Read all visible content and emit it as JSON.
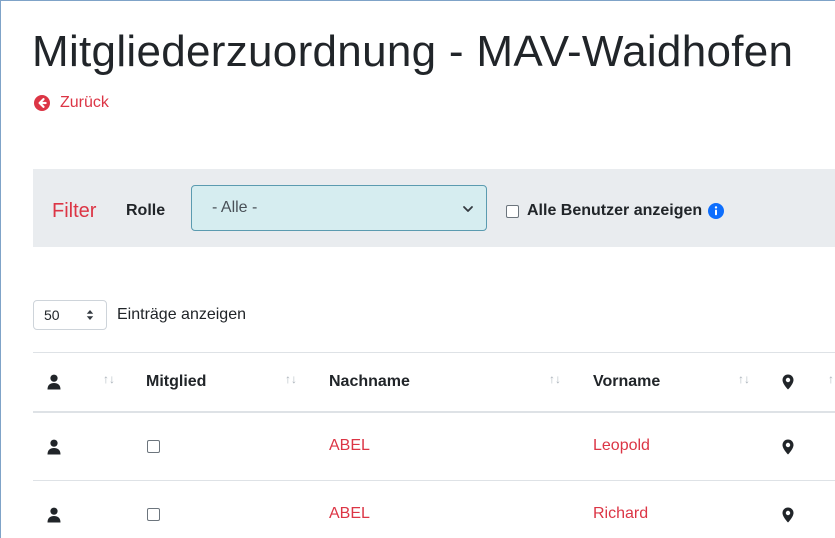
{
  "page": {
    "title": "Mitgliederzuordnung - MAV-Waidhofen",
    "back_label": "Zurück"
  },
  "filter": {
    "label": "Filter",
    "role_label": "Rolle",
    "role_selected": "- Alle -",
    "all_users_label": "Alle Benutzer anzeigen",
    "all_users_checked": false
  },
  "length": {
    "selected": "50",
    "label": "Einträge anzeigen"
  },
  "table": {
    "columns": [
      "",
      "Mitglied",
      "Nachname",
      "Vorname",
      ""
    ],
    "rows": [
      {
        "member": false,
        "last_name": "ABEL",
        "first_name": "Leopold"
      },
      {
        "member": false,
        "last_name": "ABEL",
        "first_name": "Richard"
      }
    ]
  },
  "colors": {
    "accent_red": "#dc3545",
    "filter_bg": "#e9ecef",
    "select_bg": "#d6edf0",
    "info_blue": "#0d6efd"
  }
}
